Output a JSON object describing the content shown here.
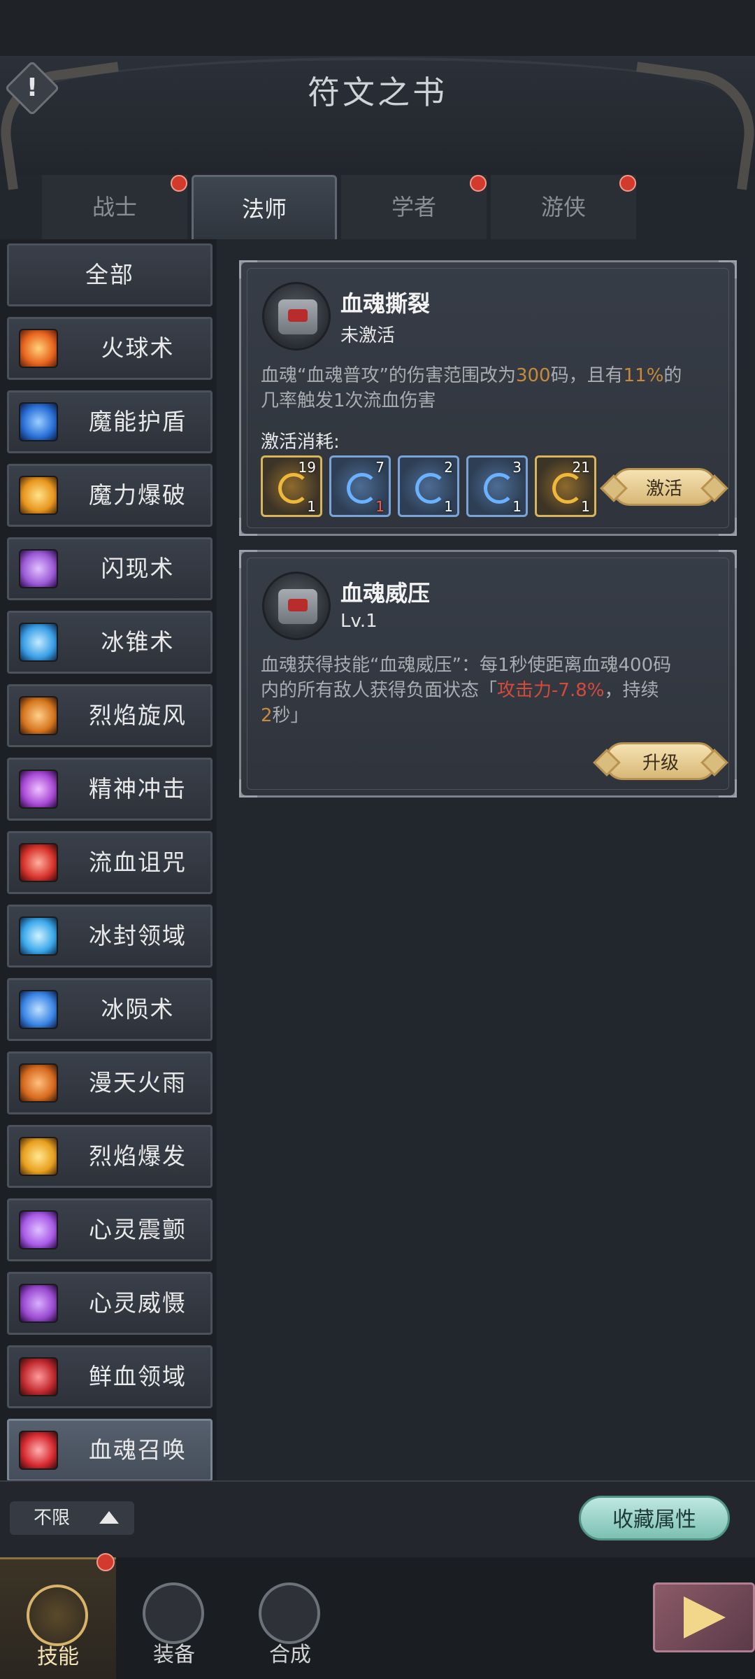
{
  "header": {
    "title": "符文之书",
    "info_icon": "exclamation-icon"
  },
  "tabs": [
    {
      "label": "战士",
      "active": false,
      "badge": true
    },
    {
      "label": "法师",
      "active": true,
      "badge": false
    },
    {
      "label": "学者",
      "active": false,
      "badge": true
    },
    {
      "label": "游侠",
      "active": false,
      "badge": true
    }
  ],
  "sidebar": {
    "items": [
      {
        "label": "全部"
      },
      {
        "label": "火球术",
        "color": "#e8641e"
      },
      {
        "label": "魔能护盾",
        "color": "#2a6fd6"
      },
      {
        "label": "魔力爆破",
        "color": "#e8961e"
      },
      {
        "label": "闪现术",
        "color": "#9b5ad6"
      },
      {
        "label": "冰锥术",
        "color": "#3a9ee6"
      },
      {
        "label": "烈焰旋风",
        "color": "#d6761e"
      },
      {
        "label": "精神冲击",
        "color": "#a84ad6"
      },
      {
        "label": "流血诅咒",
        "color": "#d6322a"
      },
      {
        "label": "冰封领域",
        "color": "#3aa8ea"
      },
      {
        "label": "冰陨术",
        "color": "#3a86e6"
      },
      {
        "label": "漫天火雨",
        "color": "#d66a1e"
      },
      {
        "label": "烈焰爆发",
        "color": "#e8a01e"
      },
      {
        "label": "心灵震颤",
        "color": "#a85ae6"
      },
      {
        "label": "心灵威慑",
        "color": "#9a4ad0"
      },
      {
        "label": "鲜血领域",
        "color": "#c02a30"
      },
      {
        "label": "血魂召唤",
        "color": "#d62a30"
      }
    ]
  },
  "card1": {
    "title": "血魂撕裂",
    "status": "未激活",
    "desc_a": "血魂“血魂普攻”的伤害范围改为",
    "desc_val1": "300",
    "desc_b": "码，且有",
    "desc_val2": "11%",
    "desc_c": "的",
    "desc_d": "几率触发1次流血伤害",
    "cost_label": "激活消耗:",
    "materials": [
      {
        "need": "19",
        "have": "1",
        "type": "gold"
      },
      {
        "need": "7",
        "have": "1",
        "type": "blue",
        "short": true
      },
      {
        "need": "2",
        "have": "1",
        "type": "blue"
      },
      {
        "need": "3",
        "have": "1",
        "type": "blue"
      },
      {
        "need": "21",
        "have": "1",
        "type": "gold"
      }
    ],
    "button": "激活"
  },
  "card2": {
    "title": "血魂威压",
    "level": "Lv.1",
    "desc_a": "血魂获得技能“血魂威压”：每1秒使距离血魂400码",
    "desc_b": "内的所有敌人获得负面状态「",
    "desc_red": "攻击力-7.8%",
    "desc_c": "，持续",
    "desc_val": "2",
    "desc_d": "秒」",
    "button": "升级"
  },
  "filter": {
    "label": "不限",
    "collect": "收藏属性"
  },
  "bottom_nav": [
    {
      "label": "技能",
      "active": true,
      "badge": true
    },
    {
      "label": "装备",
      "active": false
    },
    {
      "label": "合成",
      "active": false
    }
  ]
}
